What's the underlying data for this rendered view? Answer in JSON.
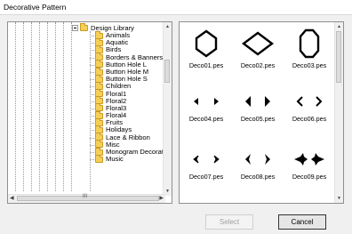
{
  "window": {
    "title": "Decorative Pattern"
  },
  "tree": {
    "root": "Design Library",
    "items": [
      "Animals",
      "Aquatic",
      "Birds",
      "Borders & Banners",
      "Button Hole L",
      "Button Hole M",
      "Button Hole S",
      "Children",
      "Floral1",
      "Floral2",
      "Floral3",
      "Floral4",
      "Fruits",
      "Holidays",
      "Lace & Ribbon",
      "Misc",
      "Monogram Decoration",
      "Music"
    ],
    "hscroll_grip": "III"
  },
  "patterns": [
    {
      "file": "Deco01.pes",
      "icon": "hexagon-outline-icon"
    },
    {
      "file": "Deco02.pes",
      "icon": "diamond-outline-icon"
    },
    {
      "file": "Deco03.pes",
      "icon": "octagon-outline-icon"
    },
    {
      "file": "Deco04.pes",
      "icon": "triangle-pair-small-icon"
    },
    {
      "file": "Deco05.pes",
      "icon": "triangle-pair-large-icon"
    },
    {
      "file": "Deco06.pes",
      "icon": "chevron-pair-icon"
    },
    {
      "file": "Deco07.pes",
      "icon": "arrowhead-pair-icon"
    },
    {
      "file": "Deco08.pes",
      "icon": "thin-chevron-pair-icon"
    },
    {
      "file": "Deco09.pes",
      "icon": "ornament-pair-icon"
    }
  ],
  "buttons": {
    "select": "Select",
    "cancel": "Cancel"
  }
}
